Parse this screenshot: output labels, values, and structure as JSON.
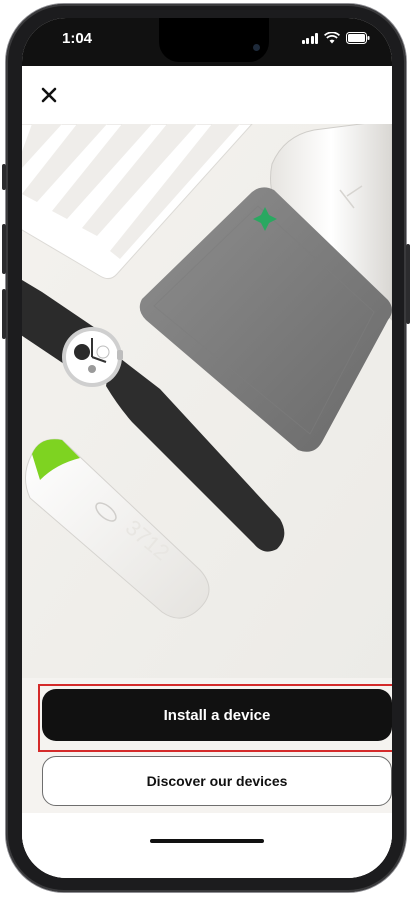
{
  "status_bar": {
    "time": "1:04",
    "icons": [
      "cellular-signal-icon",
      "wifi-icon",
      "battery-icon"
    ]
  },
  "header": {
    "close_icon": "close-icon"
  },
  "hero": {
    "content": "product-photo",
    "device_names": [
      "smart-scale",
      "hybrid-watch",
      "blood-pressure-monitor",
      "thermometer"
    ]
  },
  "actions": {
    "install_label": "Install a device",
    "discover_label": "Discover our devices"
  },
  "colors": {
    "primary_button": "#111111",
    "highlight_border": "#d42a2a",
    "background": "#f5f3f0",
    "accent_green": "#7ed321"
  }
}
